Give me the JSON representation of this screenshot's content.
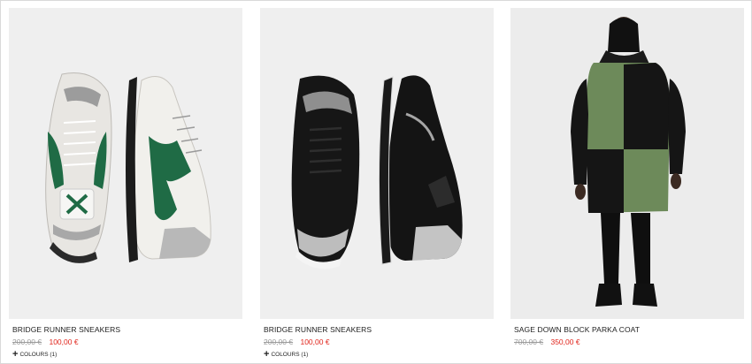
{
  "products": [
    {
      "name": "BRIDGE RUNNER SNEAKERS",
      "old_price": "200,00 €",
      "new_price": "100,00 €",
      "colours_label": "COLOURS (1)",
      "image": "white-green-sneakers",
      "accent": "#1f6b45"
    },
    {
      "name": "BRIDGE RUNNER SNEAKERS",
      "old_price": "200,00 €",
      "new_price": "100,00 €",
      "colours_label": "COLOURS (1)",
      "image": "black-sneakers",
      "accent": "#111111"
    },
    {
      "name": "SAGE DOWN BLOCK PARKA COAT",
      "old_price": "700,00 €",
      "new_price": "350,00 €",
      "image": "green-black-parka-model",
      "accent": "#6d8a5a"
    }
  ],
  "colors": {
    "sale_price": "#e0241b",
    "old_price": "#9a9a9a",
    "image_bg": "#efefef"
  },
  "icons": {
    "colours_toggle": "plus-icon"
  }
}
